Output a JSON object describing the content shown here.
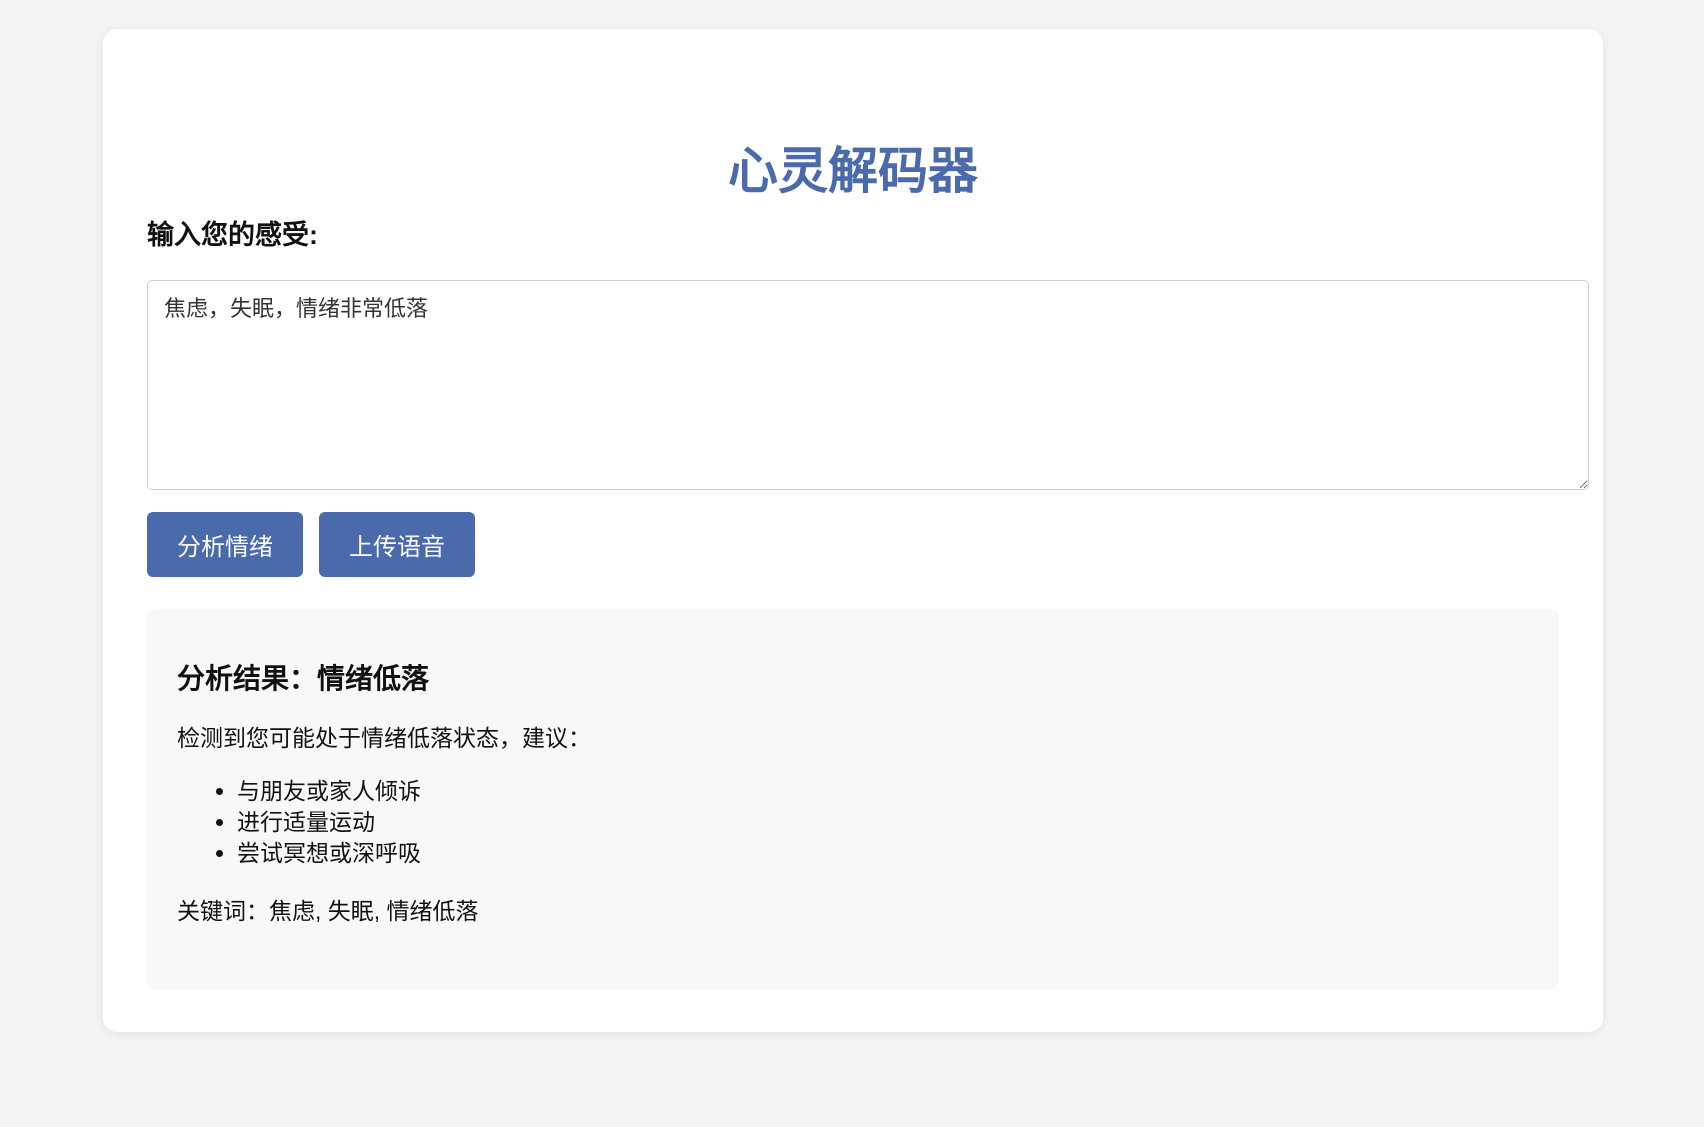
{
  "app": {
    "title": "心灵解码器"
  },
  "input": {
    "label": "输入您的感受:",
    "value": "焦虑，失眠，情绪非常低落"
  },
  "buttons": {
    "analyze_label": "分析情绪",
    "upload_label": "上传语音"
  },
  "result": {
    "title": "分析结果：情绪低落",
    "intro": "检测到您可能处于情绪低落状态，建议：",
    "suggestions": [
      "与朋友或家人倾诉",
      "进行适量运动",
      "尝试冥想或深呼吸"
    ],
    "keywords_text": "关键词：焦虑, 失眠, 情绪低落"
  },
  "colors": {
    "accent": "#4a6aab",
    "page_background": "#f4f4f4",
    "card_background": "#ffffff",
    "result_background": "#f8f8f8"
  }
}
